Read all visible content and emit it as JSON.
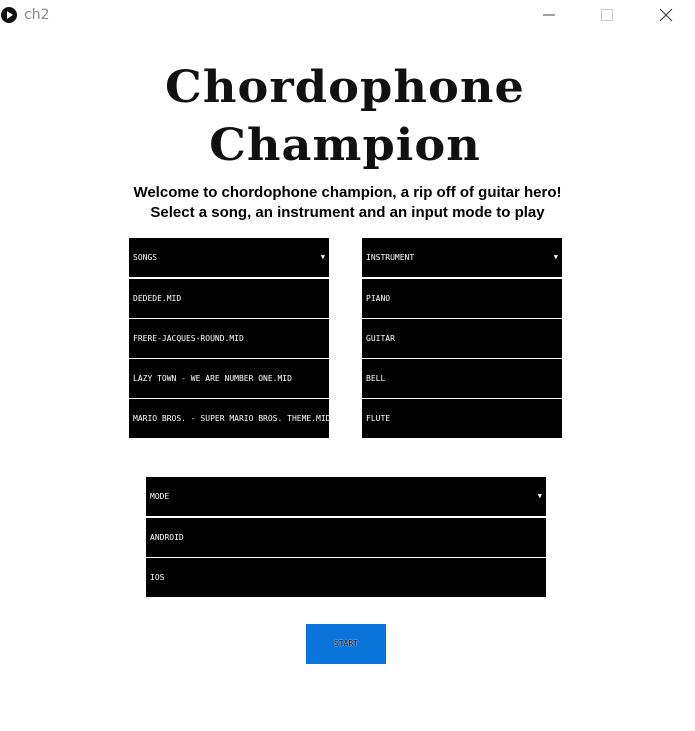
{
  "window": {
    "title": "ch2",
    "icons": {
      "app": "play-circle-icon",
      "minimize": "minimize-icon",
      "maximize": "maximize-icon",
      "close": "close-icon"
    }
  },
  "logo": {
    "line1": "Chordophone",
    "line2": "Champion"
  },
  "welcome": {
    "line1": "Welcome to chordophone champion, a rip off of guitar hero!",
    "line2": "Select a song, an instrument and an input mode to play"
  },
  "songs": {
    "header": "SONGS",
    "items": [
      "DEDEDE.MID",
      "FRERE-JACQUES-ROUND.MID",
      "LAZY TOWN - WE ARE NUMBER ONE.MID",
      "MARIO BROS. - SUPER MARIO BROS. THEME.MID"
    ]
  },
  "instrument": {
    "header": "INSTRUMENT",
    "items": [
      "PIANO",
      "GUITAR",
      "BELL",
      "FLUTE"
    ]
  },
  "mode": {
    "header": "MODE",
    "items": [
      "ANDROID",
      "IOS"
    ]
  },
  "start_label": "START",
  "colors": {
    "list_bg": "#000000",
    "list_text": "#ffffff",
    "start_bg": "#0a74da"
  }
}
